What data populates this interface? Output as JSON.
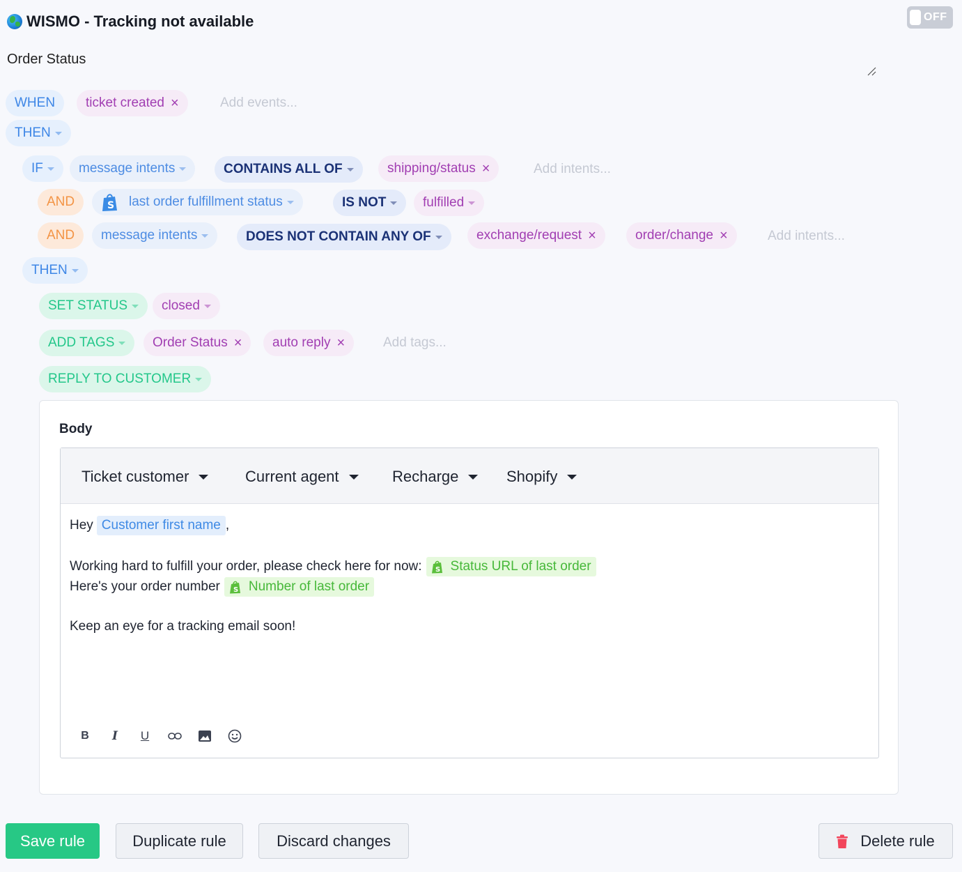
{
  "header": {
    "title": "WISMO - Tracking not available",
    "toggle_label": "OFF",
    "description": "Order Status"
  },
  "rule": {
    "when": {
      "keyword": "WHEN",
      "event": "ticket created",
      "events_placeholder": "Add events..."
    },
    "then_1": "THEN",
    "if_block": {
      "keyword": "IF",
      "field": "message intents",
      "operator": "CONTAINS ALL OF",
      "values": [
        "shipping/status"
      ],
      "placeholder": "Add intents..."
    },
    "and_1": {
      "keyword": "AND",
      "field": "last order fulfillment status",
      "operator": "IS NOT",
      "value": "fulfilled"
    },
    "and_2": {
      "keyword": "AND",
      "field": "message intents",
      "operator": "DOES NOT CONTAIN ANY OF",
      "values": [
        "exchange/request",
        "order/change"
      ],
      "placeholder": "Add intents..."
    },
    "then_2": "THEN",
    "actions": {
      "set_status": {
        "label": "SET STATUS",
        "value": "closed"
      },
      "add_tags": {
        "label": "ADD TAGS",
        "tags": [
          "Order Status",
          "auto reply"
        ],
        "placeholder": "Add tags..."
      },
      "reply": {
        "label": "REPLY TO CUSTOMER"
      }
    }
  },
  "reply_card": {
    "body_label": "Body",
    "variable_menus": [
      "Ticket customer",
      "Current agent",
      "Recharge",
      "Shopify"
    ],
    "message": {
      "greeting": "Hey",
      "customer_var": "Customer first name",
      "comma": ",",
      "line2": "Working hard to fulfill your order, please check here for now:",
      "status_url_var": "Status URL of last order",
      "line3": "Here's your order number",
      "order_number_var": "Number of last order",
      "line4": "Keep an eye for a tracking email soon!"
    },
    "format_buttons": [
      "bold-icon",
      "italic-icon",
      "underline-icon",
      "link-icon",
      "image-icon",
      "emoji-icon"
    ]
  },
  "buttons": {
    "save": "Save rule",
    "duplicate": "Duplicate rule",
    "discard": "Discard changes",
    "delete": "Delete rule"
  },
  "colors": {
    "primary_green": "#27c885",
    "keyword_blue": "#3d86e6",
    "keyword_orange": "#f39445",
    "keyword_green": "#23c78a",
    "value_purple": "#a13eb2",
    "operator_navy": "#1b3276",
    "delete_red": "#f2455b"
  }
}
